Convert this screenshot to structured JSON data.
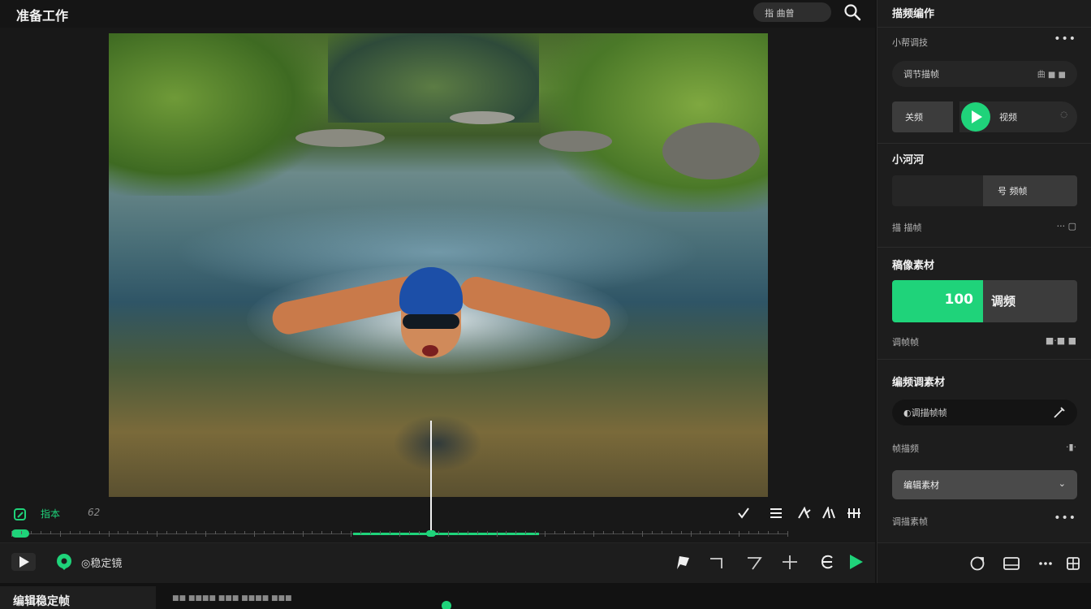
{
  "header": {
    "title": "准备工作",
    "pill_label": "指 曲曾",
    "search_icon": "search-icon"
  },
  "timeline": {
    "left_label": "指本",
    "left_badge": "62",
    "progress_start": 0.44,
    "progress_end": 0.68,
    "playhead": 0.54,
    "tool_icons": [
      "check-icon",
      "menu-icon",
      "cut-icon",
      "split-icon",
      "more-icon"
    ]
  },
  "controlbar": {
    "location_label": "◎稳定镜",
    "colors": {
      "accent": "#1fd37a"
    }
  },
  "bottom": {
    "title": "编辑稳定帧",
    "info": "■■ ■■■■ ■■■  ■■■■ ■■■"
  },
  "panel": {
    "section1": {
      "title": "描频编作",
      "sub": "小帮调技",
      "field": "调节描帧",
      "field_right": "曲 ■ ■"
    },
    "play_row": {
      "left": "关频",
      "right": "视频",
      "right_icon": "◌"
    },
    "section2": {
      "title": "小河河",
      "seg_right": "号 频帧",
      "sub": "描 描帧",
      "sub_right": "··· ▢"
    },
    "section3": {
      "title": "稿像素材",
      "value": "100",
      "value_label": "调频",
      "sub": "调帧帧",
      "sub_right": "■·■ ■"
    },
    "section4": {
      "title": "编频调素材",
      "search_field": "◐调描帧帧",
      "sub": "帧描频",
      "sub_right": "·▮·",
      "dropdown": "编辑素材",
      "footer": "调描素帧"
    }
  }
}
